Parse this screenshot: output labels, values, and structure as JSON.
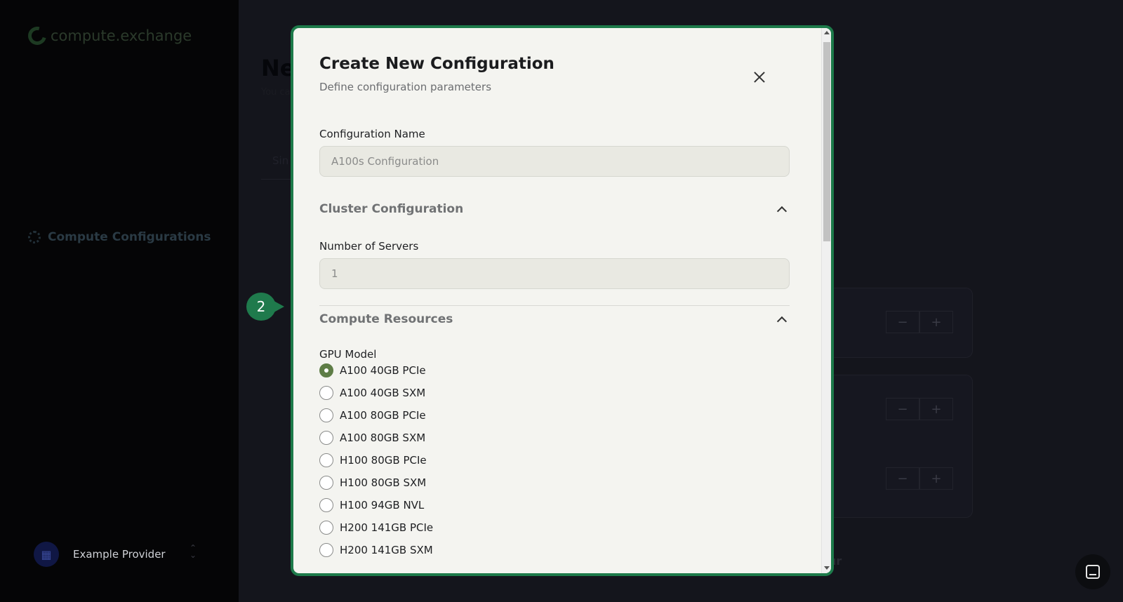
{
  "app": {
    "logo_text": "compute.exchange",
    "nav_item": "Compute Configurations",
    "user_name": "Example Provider",
    "bg_title": "Ne",
    "bg_subtitle": "You ca",
    "bg_tab": "Sin",
    "bg_tour_fragment": "ur",
    "stepper_minus": "−",
    "stepper_plus": "+"
  },
  "tour": {
    "step": "2"
  },
  "modal": {
    "title": "Create New Configuration",
    "subtitle": "Define configuration parameters",
    "config_name": {
      "label": "Configuration Name",
      "placeholder": "A100s Configuration"
    },
    "cluster": {
      "heading": "Cluster Configuration",
      "servers_label": "Number of Servers",
      "servers_placeholder": "1"
    },
    "compute": {
      "heading": "Compute Resources",
      "gpu_label": "GPU Model",
      "gpu_options": [
        {
          "label": "A100 40GB PCIe",
          "checked": true
        },
        {
          "label": "A100 40GB SXM",
          "checked": false
        },
        {
          "label": "A100 80GB PCIe",
          "checked": false
        },
        {
          "label": "A100 80GB SXM",
          "checked": false
        },
        {
          "label": "H100 80GB PCIe",
          "checked": false
        },
        {
          "label": "H100 80GB SXM",
          "checked": false
        },
        {
          "label": "H100 94GB NVL",
          "checked": false
        },
        {
          "label": "H200 141GB PCIe",
          "checked": false
        },
        {
          "label": "H200 141GB SXM",
          "checked": false
        }
      ]
    }
  },
  "colors": {
    "accent": "#1d7a4a",
    "radio_checked": "#5e7d46"
  }
}
